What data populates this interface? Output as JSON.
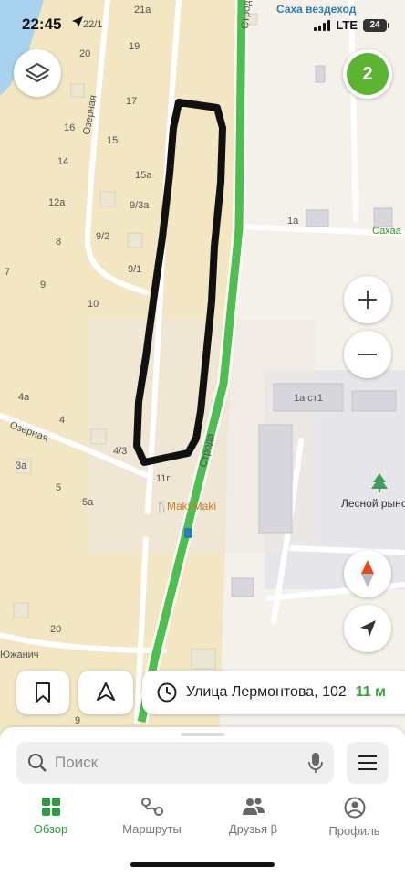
{
  "status_bar": {
    "time": "22:45",
    "network": "LTE",
    "battery": "24",
    "top_label": "Саха вездеход"
  },
  "map": {
    "streets": [
      "Озерная",
      "Озерная",
      "Строда",
      "Строда",
      "Южанич"
    ],
    "house_numbers": [
      "21а",
      "22/1",
      "20",
      "19",
      "17",
      "16",
      "15",
      "14",
      "15а",
      "12а",
      "9/3а",
      "8",
      "9/2",
      "9/1",
      "7",
      "9",
      "10",
      "4а",
      "4",
      "4/3",
      "3а",
      "5",
      "5а",
      "20",
      "9",
      "11г",
      "1а",
      "1а ст1"
    ],
    "pois": [
      "Maki Maki",
      "Лесной рынок",
      "Сахаа"
    ],
    "colors": {
      "background": "#f1efe6",
      "residential": "#f2e6c3",
      "industrial": "#e6e6ea",
      "highway": "#4cbf4f",
      "outline": "#111111",
      "accent": "#2e9b3c"
    }
  },
  "controls": {
    "layers_icon": "layers-icon",
    "badge_count": "2",
    "zoom_in": "+",
    "zoom_out": "−",
    "compass_icon": "compass-icon",
    "navigate_icon": "navigate-arrow-icon"
  },
  "chips": {
    "bookmark_icon": "bookmark-icon",
    "poi_icon": "location-pin-icon",
    "route_icon": "clock-icon",
    "route_text": "Улица Лермонтова, 102",
    "route_time": "11 м"
  },
  "search": {
    "placeholder": "Поиск",
    "search_icon": "search-icon",
    "mic_icon": "microphone-icon",
    "menu_icon": "hamburger-menu-icon"
  },
  "tabs": [
    {
      "label": "Обзор",
      "icon": "grid-icon",
      "active": true
    },
    {
      "label": "Маршруты",
      "icon": "routes-icon",
      "active": false
    },
    {
      "label": "Друзья β",
      "icon": "friends-icon",
      "active": false
    },
    {
      "label": "Профиль",
      "icon": "profile-icon",
      "active": false
    }
  ]
}
